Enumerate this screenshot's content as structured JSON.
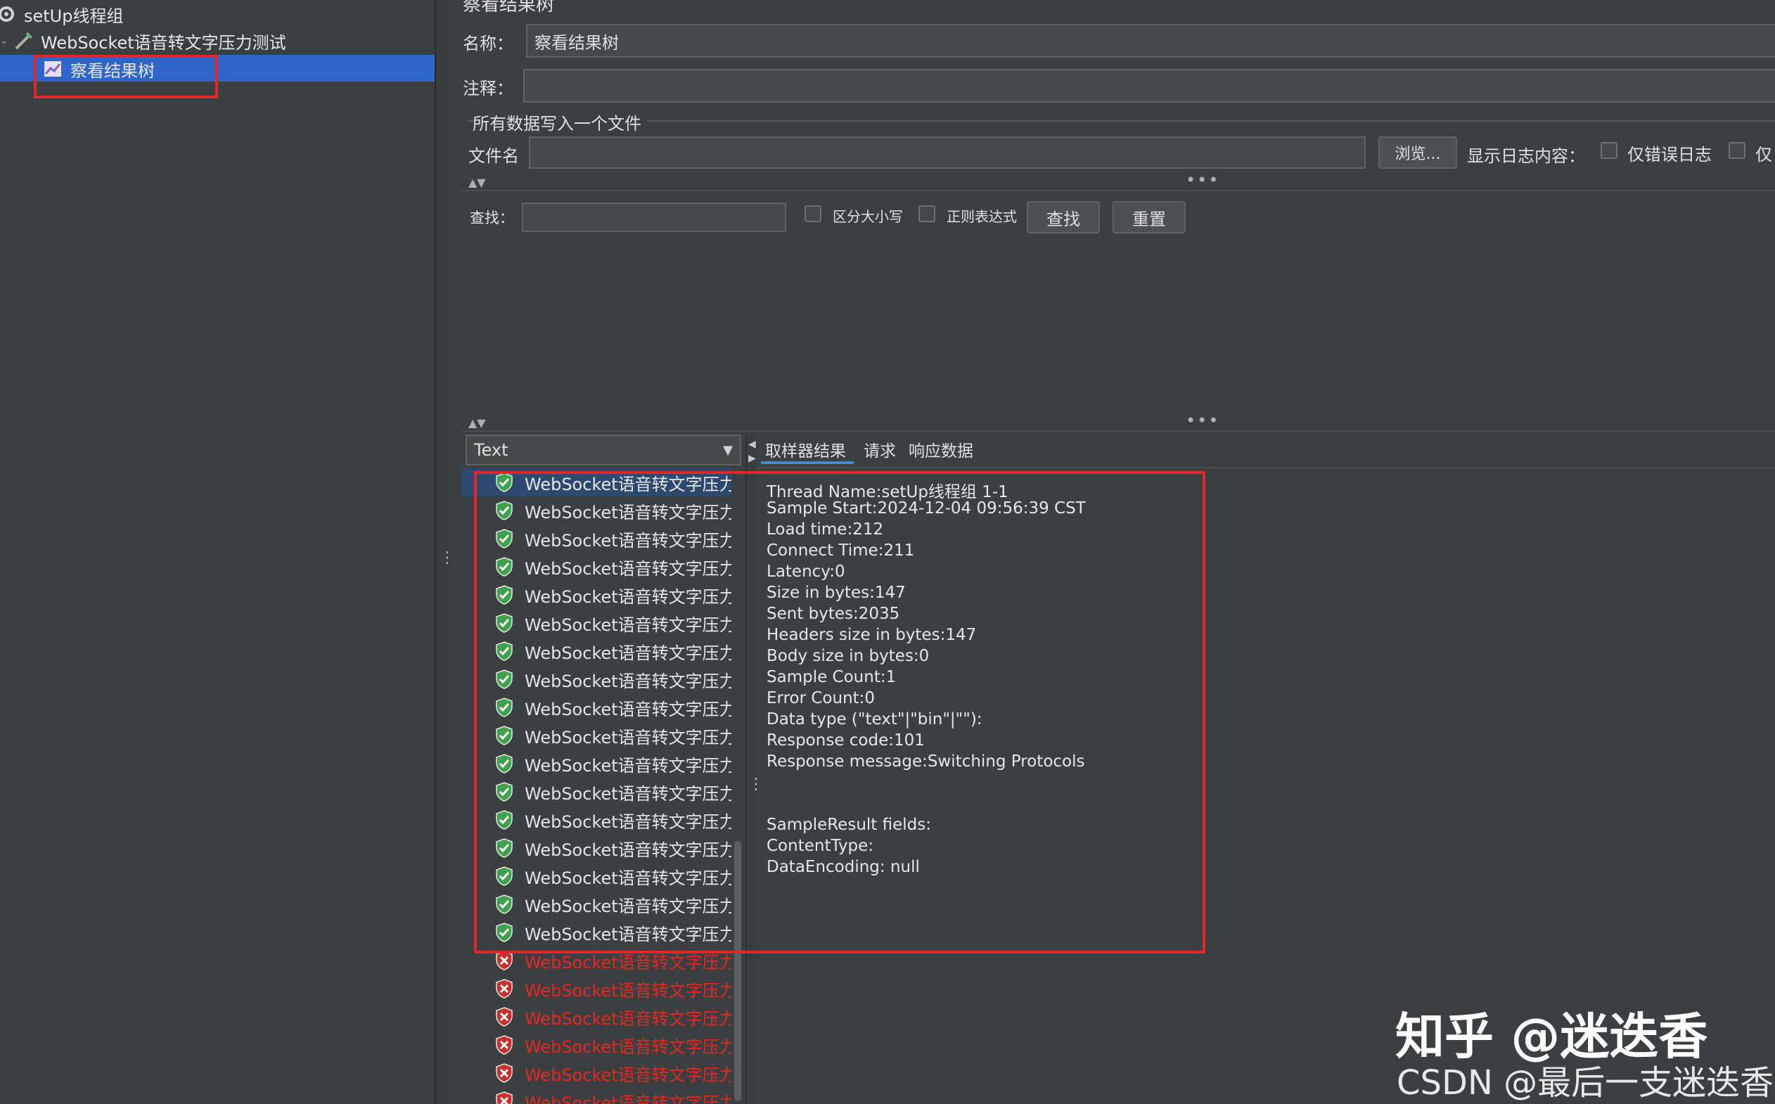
{
  "tree": {
    "items": [
      {
        "label": "setUp线程组"
      },
      {
        "label": "WebSocket语音转文字压力测试"
      },
      {
        "label": "察看结果树"
      }
    ]
  },
  "panel": {
    "title": "察看结果树",
    "name_label": "名称：",
    "name_value": "察看结果树",
    "comment_label": "注释：",
    "comment_value": "",
    "file_section_label": "所有数据写入一个文件",
    "filename_label": "文件名",
    "filename_value": "",
    "browse_button": "浏览...",
    "log_content_label": "显示日志内容：",
    "errors_only_label": "仅错误日志",
    "success_only_label": "仅"
  },
  "search": {
    "label": "查找：",
    "value": "",
    "case_sensitive_label": "区分大小写",
    "regex_label": "正则表达式",
    "find_button": "查找",
    "reset_button": "重置"
  },
  "results": {
    "renderer_selected": "Text",
    "tabs": [
      "取样器结果",
      "请求",
      "响应数据"
    ],
    "items": [
      {
        "label": "WebSocket语音转文字压力",
        "status": "ok"
      },
      {
        "label": "WebSocket语音转文字压力",
        "status": "ok"
      },
      {
        "label": "WebSocket语音转文字压力",
        "status": "ok"
      },
      {
        "label": "WebSocket语音转文字压力",
        "status": "ok"
      },
      {
        "label": "WebSocket语音转文字压力",
        "status": "ok"
      },
      {
        "label": "WebSocket语音转文字压力",
        "status": "ok"
      },
      {
        "label": "WebSocket语音转文字压力",
        "status": "ok"
      },
      {
        "label": "WebSocket语音转文字压力",
        "status": "ok"
      },
      {
        "label": "WebSocket语音转文字压力",
        "status": "ok"
      },
      {
        "label": "WebSocket语音转文字压力",
        "status": "ok"
      },
      {
        "label": "WebSocket语音转文字压力",
        "status": "ok"
      },
      {
        "label": "WebSocket语音转文字压力",
        "status": "ok"
      },
      {
        "label": "WebSocket语音转文字压力",
        "status": "ok"
      },
      {
        "label": "WebSocket语音转文字压力",
        "status": "ok"
      },
      {
        "label": "WebSocket语音转文字压力",
        "status": "ok"
      },
      {
        "label": "WebSocket语音转文字压力",
        "status": "ok"
      },
      {
        "label": "WebSocket语音转文字压力",
        "status": "ok"
      },
      {
        "label": "WebSocket语音转文字压力",
        "status": "error"
      },
      {
        "label": "WebSocket语音转文字压力",
        "status": "error"
      },
      {
        "label": "WebSocket语音转文字压力",
        "status": "error"
      },
      {
        "label": "WebSocket语音转文字压力",
        "status": "error"
      },
      {
        "label": "WebSocket语音转文字压力",
        "status": "error"
      },
      {
        "label": "WebSocket语音转文字压力",
        "status": "error"
      }
    ],
    "detail_lines": [
      "Thread Name:setUp线程组 1-1",
      "Sample Start:2024-12-04 09:56:39 CST",
      "Load time:212",
      "Connect Time:211",
      "Latency:0",
      "Size in bytes:147",
      "Sent bytes:2035",
      "Headers size in bytes:147",
      "Body size in bytes:0",
      "Sample Count:1",
      "Error Count:0",
      "Data type (\"text\"|\"bin\"|\"\"):",
      "Response code:101",
      "Response message:Switching Protocols",
      "",
      "",
      "SampleResult fields:",
      "ContentType:",
      "DataEncoding: null"
    ]
  },
  "watermark": {
    "line1": "知乎 @迷迭香",
    "line2": "CSDN @最后一支迷迭香"
  },
  "colors": {
    "background": "#3c3f41",
    "selection": "#2f65ca",
    "highlight_box": "#e3262a",
    "success": "#3fa34d",
    "error": "#e8261f"
  }
}
